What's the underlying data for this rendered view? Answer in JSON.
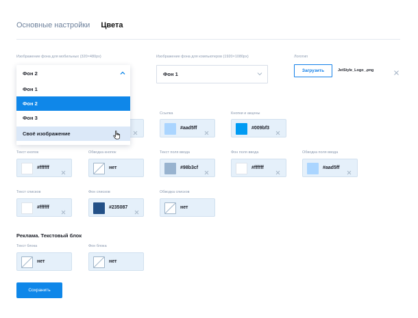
{
  "tabs": {
    "basic": "Основные настройки",
    "colors": "Цвета"
  },
  "bg_mobile": {
    "label": "Изображение фона для мобильных (320×480px)",
    "value": "Фон 2"
  },
  "bg_desktop": {
    "label": "Изображение фона для компьютеров (1920×1080px)",
    "value": "Фон 1"
  },
  "logo": {
    "label": "Логотип",
    "upload_label": "Загрузить",
    "file_name": "JetStyle_Logo_.png"
  },
  "dropdown": {
    "current": "Фон 2",
    "options": [
      "Фон 1",
      "Фон 2",
      "Фон 3",
      "Своё изображение"
    ],
    "selected_index": 1,
    "hovered_index": 3
  },
  "colors": {
    "link": {
      "label": "Ссылка",
      "value": "#aad5ff",
      "swatch": "#aad5ff"
    },
    "buttons_accents": {
      "label": "Кнопки и акцены",
      "value": "#009bf3",
      "swatch": "#009bf3"
    },
    "button_text": {
      "label": "Текст кнопок",
      "value": "#ffffff",
      "swatch": "#ffffff"
    },
    "button_border": {
      "label": "Обводка кнопок",
      "value": "нет"
    },
    "input_text": {
      "label": "Текст поля ввода",
      "value": "#98b3cf",
      "swatch": "#98b3cf"
    },
    "input_bg": {
      "label": "Фон поля ввода",
      "value": "#ffffff",
      "swatch": "#ffffff"
    },
    "input_border": {
      "label": "Обводка поля ввода",
      "value": "#aad5ff",
      "swatch": "#aad5ff"
    },
    "list_text": {
      "label": "Текст списков",
      "value": "#ffffff",
      "swatch": "#ffffff"
    },
    "list_bg": {
      "label": "Фон списков",
      "value": "#235087",
      "swatch": "#235087"
    },
    "list_border": {
      "label": "Обводка списков",
      "value": "нет"
    }
  },
  "ad_section": {
    "title": "Реклама. Текстовый блок",
    "block_text": {
      "label": "Текст блока",
      "value": "нет"
    },
    "block_bg": {
      "label": "Фон блока",
      "value": "нет"
    }
  },
  "save_label": "Сохранить",
  "accent_color": "#0f87e9"
}
